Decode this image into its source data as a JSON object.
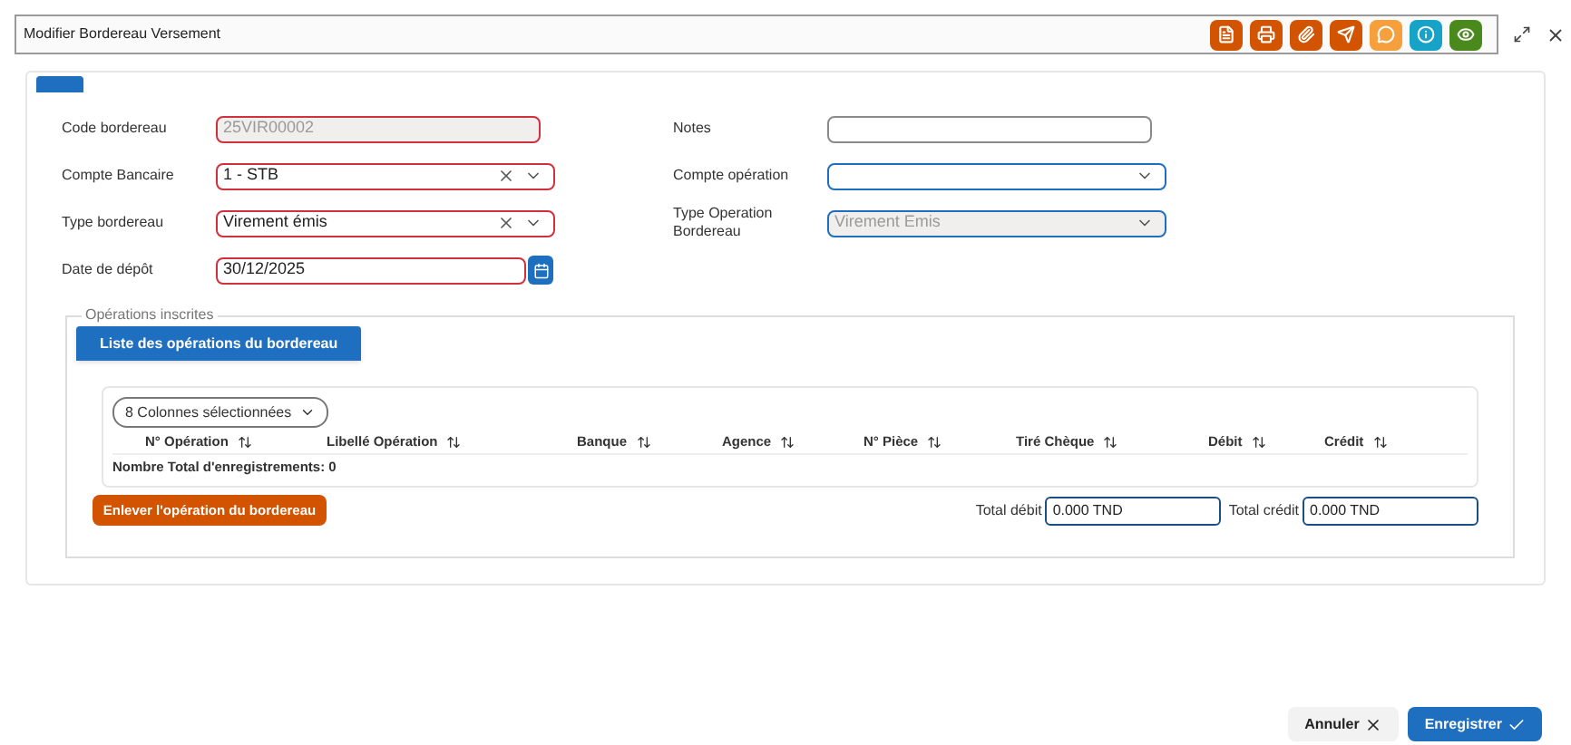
{
  "window": {
    "title": "Modifier Bordereau Versement"
  },
  "toolbar": [
    {
      "kind": "document",
      "color": "#d35400"
    },
    {
      "kind": "print",
      "color": "#d35400"
    },
    {
      "kind": "attach",
      "color": "#d35400"
    },
    {
      "kind": "send",
      "color": "#d35400"
    },
    {
      "kind": "comment",
      "color": "#f5a03c"
    },
    {
      "kind": "info",
      "color": "#17a2c8"
    },
    {
      "kind": "view",
      "color": "#4a8a1c"
    }
  ],
  "form": {
    "left": [
      {
        "label": "Code bordereau",
        "kind": "text",
        "value": "25VIR00002",
        "disabled": true,
        "invalid": true
      },
      {
        "label": "Compte Bancaire",
        "kind": "select",
        "value": "1 - STB",
        "disabled": false,
        "invalid": true,
        "clearable": true
      },
      {
        "label": "Type bordereau",
        "kind": "select",
        "value": "Virement émis",
        "disabled": false,
        "invalid": true,
        "clearable": true
      },
      {
        "label": "Date de dépôt",
        "kind": "date",
        "value": "30/12/2025",
        "disabled": false,
        "invalid": true
      }
    ],
    "right": [
      {
        "label": "Notes",
        "kind": "text",
        "disabled": false,
        "invalid": false
      },
      {
        "label": "Compte opération",
        "kind": "select",
        "disabled": false,
        "invalid": false,
        "clearable": false
      },
      {
        "label": "Type Operation Bordereau",
        "kind": "select",
        "value": "Virement Emis",
        "disabled": true,
        "invalid": false,
        "clearable": false
      }
    ]
  },
  "operations": {
    "legend": "Opérations inscrites",
    "tabs": [
      {
        "label": "Liste des opérations du bordereau",
        "selected": true
      }
    ],
    "column_picker": "8 Colonnes sélectionnées",
    "table": {
      "columns": [
        "N° Opération",
        "Libellé Opération",
        "Banque",
        "Agence",
        "N° Pièce",
        "Tiré Chèque",
        "Débit",
        "Crédit"
      ],
      "footer": "Nombre Total d'enregistrements: 0"
    },
    "remove_button": "Enlever l'opération du bordereau",
    "totals": [
      {
        "label": "Total débit",
        "value": "0.000 TND"
      },
      {
        "label": "Total crédit",
        "value": "0.000 TND"
      }
    ]
  },
  "buttons": [
    {
      "label": "Annuler",
      "kind": "cancel"
    },
    {
      "label": "Enregistrer",
      "kind": "save"
    }
  ]
}
